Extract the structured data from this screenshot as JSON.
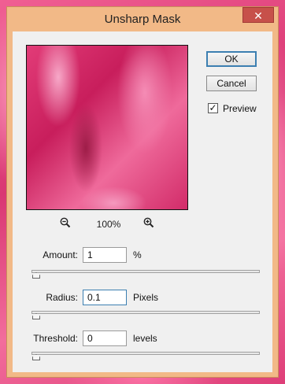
{
  "window": {
    "title": "Unsharp Mask",
    "close_glyph": "✕"
  },
  "preview": {
    "zoom_level": "100%",
    "zoom_out_icon": "zoom-out-icon",
    "zoom_in_icon": "zoom-in-icon"
  },
  "buttons": {
    "ok": "OK",
    "cancel": "Cancel"
  },
  "preview_toggle": {
    "label": "Preview",
    "checked": true,
    "check_glyph": "✓"
  },
  "params": {
    "amount": {
      "label": "Amount:",
      "value": "1",
      "unit": "%",
      "slider_fraction": 0.0
    },
    "radius": {
      "label": "Radius:",
      "value": "0.1",
      "unit": "Pixels",
      "slider_fraction": 0.0
    },
    "threshold": {
      "label": "Threshold:",
      "value": "0",
      "unit": "levels",
      "slider_fraction": 0.0
    }
  },
  "colors": {
    "title_bar": "#f2b987",
    "close_button": "#c7504a",
    "default_button_border": "#3c7fb1"
  }
}
